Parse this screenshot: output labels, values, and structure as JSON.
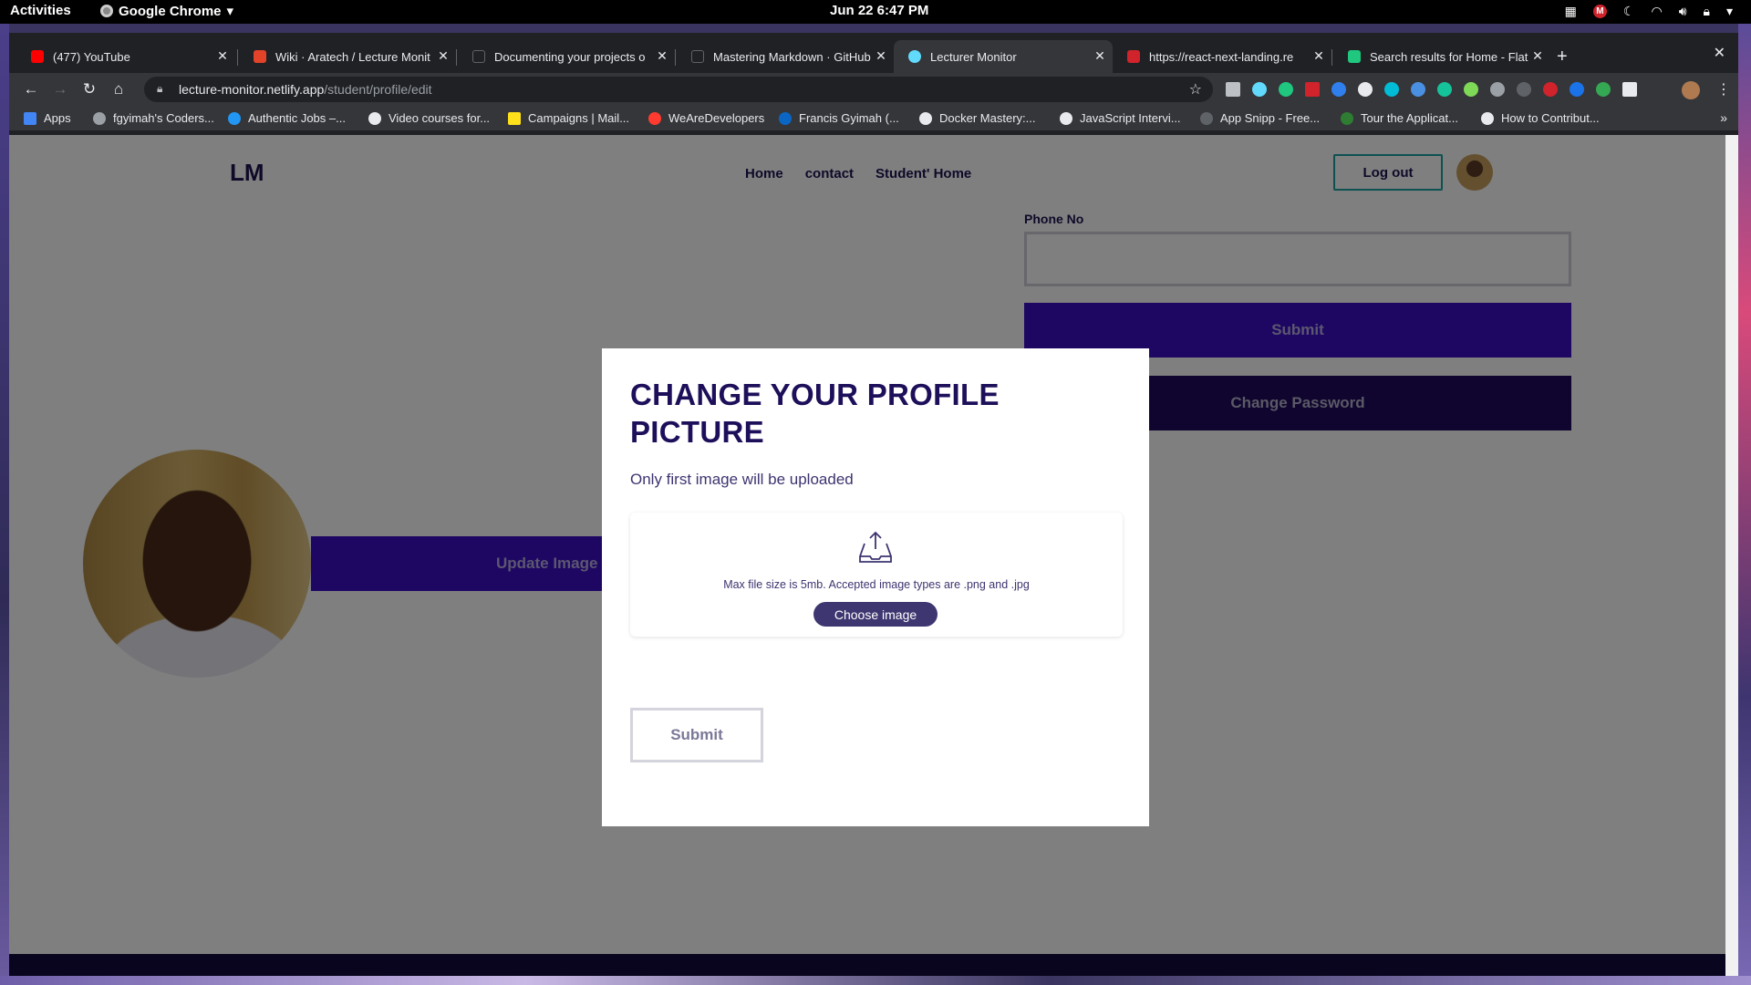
{
  "os": {
    "activities": "Activities",
    "app_menu": "Google Chrome",
    "clock": "Jun 22  6:47 PM"
  },
  "browser": {
    "tabs": [
      {
        "title": "(477) YouTube",
        "favicon_color": "#ff0000",
        "active": false
      },
      {
        "title": "Wiki · Aratech / Lecture Monit",
        "favicon_color": "#e24329",
        "active": false
      },
      {
        "title": "Documenting your projects o",
        "favicon_color": "#202124",
        "active": false
      },
      {
        "title": "Mastering Markdown · GitHub",
        "favicon_color": "#202124",
        "active": false
      },
      {
        "title": "Lecturer Monitor",
        "favicon_color": "#61dafb",
        "active": true
      },
      {
        "title": "https://react-next-landing.re",
        "favicon_color": "#d0232b",
        "active": false
      },
      {
        "title": "Search results for Home - Flat",
        "favicon_color": "#1fc77f",
        "active": false
      }
    ],
    "url_host": "lecture-monitor.netlify.app",
    "url_path": "/student/profile/edit",
    "bookmarks": [
      {
        "label": "Apps",
        "color": "#4285f4"
      },
      {
        "label": "fgyimah's Coders...",
        "color": "#9aa0a6"
      },
      {
        "label": "Authentic Jobs –...",
        "color": "#2196f3"
      },
      {
        "label": "Video courses for...",
        "color": "#e8eaed"
      },
      {
        "label": "Campaigns | Mail...",
        "color": "#ffe01b"
      },
      {
        "label": "WeAreDevelopers",
        "color": "#ff3b30"
      },
      {
        "label": "Francis Gyimah (...",
        "color": "#0a66c2"
      },
      {
        "label": "Docker Mastery:...",
        "color": "#e8eaed"
      },
      {
        "label": "JavaScript Intervi...",
        "color": "#e8eaed"
      },
      {
        "label": "App Snipp - Free...",
        "color": "#5f6368"
      },
      {
        "label": "Tour the Applicat...",
        "color": "#2e7d32"
      },
      {
        "label": "How to Contribut...",
        "color": "#e8eaed"
      }
    ]
  },
  "site": {
    "logo": "LM",
    "nav": [
      "Home",
      "contact",
      "Student' Home"
    ],
    "logout": "Log out",
    "phone_label": "Phone No",
    "phone_value": "",
    "submit": "Submit",
    "change_password": "Change Password",
    "update_image": "Update Image"
  },
  "modal": {
    "title": "CHANGE YOUR PROFILE PICTURE",
    "subtitle": "Only first image will be uploaded",
    "dropzone_text": "Max file size is 5mb. Accepted image types are .png and .jpg",
    "choose_button": "Choose image",
    "submit": "Submit"
  }
}
